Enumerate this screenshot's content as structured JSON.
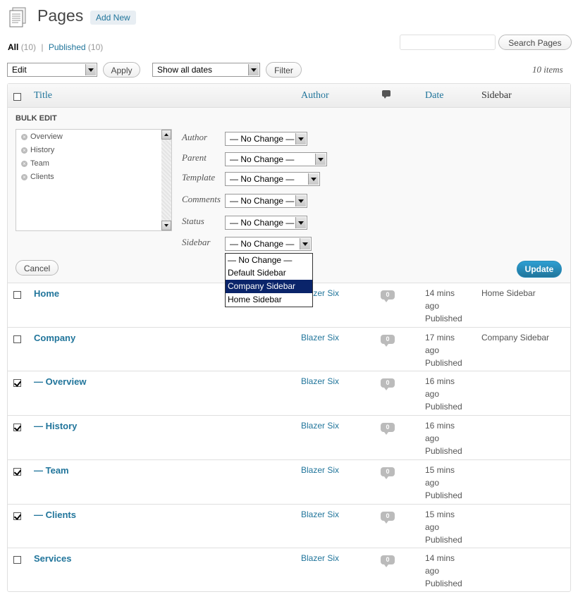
{
  "header": {
    "title": "Pages",
    "add_new": "Add New"
  },
  "filters": {
    "all_label": "All",
    "all_count": "(10)",
    "published_label": "Published",
    "published_count": "(10)",
    "separator": "|"
  },
  "search": {
    "placeholder": "",
    "button": "Search Pages"
  },
  "tablenav": {
    "bulk_action": "Edit",
    "apply": "Apply",
    "date_filter": "Show all dates",
    "filter": "Filter",
    "items_count": "10 items"
  },
  "columns": {
    "title": "Title",
    "author": "Author",
    "date": "Date",
    "sidebar": "Sidebar"
  },
  "bulk_edit": {
    "heading": "BULK EDIT",
    "selected_titles": [
      "Overview",
      "History",
      "Team",
      "Clients"
    ],
    "fields": [
      {
        "label": "Author",
        "value": "— No Change —"
      },
      {
        "label": "Parent",
        "value": "— No Change —"
      },
      {
        "label": "Template",
        "value": "— No Change —"
      },
      {
        "label": "Comments",
        "value": "— No Change —"
      },
      {
        "label": "Status",
        "value": "— No Change —"
      },
      {
        "label": "Sidebar",
        "value": "— No Change —"
      }
    ],
    "sidebar_options": [
      "— No Change —",
      "Default Sidebar",
      "Company Sidebar",
      "Home Sidebar"
    ],
    "sidebar_highlighted": "Company Sidebar",
    "cancel": "Cancel",
    "update": "Update"
  },
  "rows": [
    {
      "title": "Home",
      "author": "Blazer Six",
      "comments": "0",
      "date": "14 mins",
      "date2": "ago",
      "status": "Published",
      "sidebar": "Home Sidebar",
      "checked": false
    },
    {
      "title": "Company",
      "author": "Blazer Six",
      "comments": "0",
      "date": "17 mins",
      "date2": "ago",
      "status": "Published",
      "sidebar": "Company Sidebar",
      "checked": false
    },
    {
      "title": "— Overview",
      "author": "Blazer Six",
      "comments": "0",
      "date": "16 mins",
      "date2": "ago",
      "status": "Published",
      "sidebar": "",
      "checked": true
    },
    {
      "title": "— History",
      "author": "Blazer Six",
      "comments": "0",
      "date": "16 mins",
      "date2": "ago",
      "status": "Published",
      "sidebar": "",
      "checked": true
    },
    {
      "title": "— Team",
      "author": "Blazer Six",
      "comments": "0",
      "date": "15 mins",
      "date2": "ago",
      "status": "Published",
      "sidebar": "",
      "checked": true
    },
    {
      "title": "— Clients",
      "author": "Blazer Six",
      "comments": "0",
      "date": "15 mins",
      "date2": "ago",
      "status": "Published",
      "sidebar": "",
      "checked": true
    },
    {
      "title": "Services",
      "author": "Blazer Six",
      "comments": "0",
      "date": "14 mins",
      "date2": "ago",
      "status": "Published",
      "sidebar": "",
      "checked": false
    }
  ],
  "colors": {
    "link": "#21759b",
    "update_button": "#21759b",
    "highlight": "#0a246a"
  }
}
